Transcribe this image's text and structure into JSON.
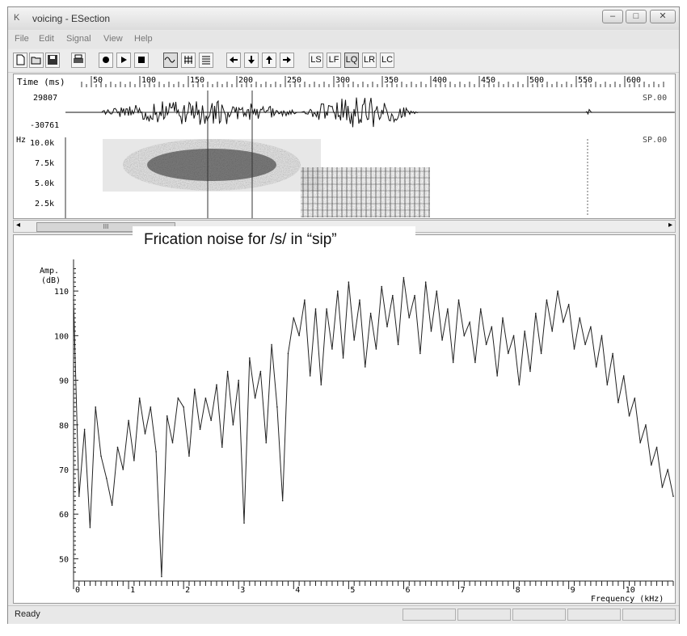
{
  "window": {
    "title": "voicing - ESection",
    "app_icon_label": "K",
    "controls": {
      "minimize": "–",
      "maximize": "□",
      "close": "✕"
    }
  },
  "menu": [
    "File",
    "Edit",
    "Signal",
    "View",
    "Help"
  ],
  "toolbar": {
    "file_buttons": [
      "new-icon",
      "open-icon",
      "save-icon",
      "print-icon"
    ],
    "transport_buttons": [
      "record-icon",
      "play-icon",
      "stop-icon"
    ],
    "view_buttons": [
      "waveform-icon",
      "spectrogram-icon",
      "spectrum-icon"
    ],
    "nav_buttons": [
      "arrow-left-icon",
      "arrow-down-icon",
      "arrow-up-icon",
      "arrow-right-icon"
    ],
    "analysis_buttons": [
      "LS",
      "LF",
      "LQ",
      "LR",
      "LC"
    ],
    "selected_analysis": "LQ"
  },
  "signal_panel": {
    "time_label": "Time (ms)",
    "time_ticks": [
      "50",
      "100",
      "150",
      "200",
      "250",
      "300",
      "350",
      "400",
      "450",
      "500",
      "550",
      "600"
    ],
    "wave_max": "29807",
    "wave_min": "-30761",
    "wave_channel": "SP.00",
    "spectrogram_unit": "Hz",
    "spectrogram_ticks": [
      "10.0k",
      "7.5k",
      "5.0k",
      "2.5k"
    ],
    "spectrogram_channel": "SP.00"
  },
  "scrollbar": {
    "thumb_label": "III",
    "left_arrow": "◂",
    "right_arrow": "▸"
  },
  "caption": "Frication noise for /s/ in “sip”",
  "spectrum": {
    "y_label_line1": "Amp.",
    "y_label_line2": "(dB)",
    "y_ticks": [
      "110",
      "100",
      "90",
      "80",
      "70",
      "60",
      "50"
    ],
    "x_ticks": [
      "0",
      "1",
      "2",
      "3",
      "4",
      "5",
      "6",
      "7",
      "8",
      "9",
      "10"
    ],
    "x_label": "Frequency (kHz)"
  },
  "chart_data": {
    "type": "line",
    "xlabel": "Frequency (kHz)",
    "ylabel": "Amp. (dB)",
    "xlim": [
      0,
      10.9
    ],
    "ylim": [
      45,
      116
    ],
    "x": [
      0.0,
      0.1,
      0.2,
      0.3,
      0.4,
      0.5,
      0.6,
      0.7,
      0.8,
      0.9,
      1.0,
      1.1,
      1.2,
      1.3,
      1.4,
      1.5,
      1.6,
      1.7,
      1.8,
      1.9,
      2.0,
      2.1,
      2.2,
      2.3,
      2.4,
      2.5,
      2.6,
      2.7,
      2.8,
      2.9,
      3.0,
      3.1,
      3.2,
      3.3,
      3.4,
      3.5,
      3.6,
      3.7,
      3.8,
      3.9,
      4.0,
      4.1,
      4.2,
      4.3,
      4.4,
      4.5,
      4.6,
      4.7,
      4.8,
      4.9,
      5.0,
      5.1,
      5.2,
      5.3,
      5.4,
      5.5,
      5.6,
      5.7,
      5.8,
      5.9,
      6.0,
      6.1,
      6.2,
      6.3,
      6.4,
      6.5,
      6.6,
      6.7,
      6.8,
      6.9,
      7.0,
      7.1,
      7.2,
      7.3,
      7.4,
      7.5,
      7.6,
      7.7,
      7.8,
      7.9,
      8.0,
      8.1,
      8.2,
      8.3,
      8.4,
      8.5,
      8.6,
      8.7,
      8.8,
      8.9,
      9.0,
      9.1,
      9.2,
      9.3,
      9.4,
      9.5,
      9.6,
      9.7,
      9.8,
      9.9,
      10.0,
      10.1,
      10.2,
      10.3,
      10.4,
      10.5,
      10.6,
      10.7,
      10.8,
      10.9
    ],
    "y": [
      108,
      64,
      79,
      57,
      84,
      73,
      68,
      62,
      75,
      70,
      81,
      72,
      86,
      78,
      84,
      74,
      46,
      82,
      76,
      86,
      84,
      73,
      88,
      79,
      86,
      81,
      89,
      75,
      92,
      80,
      90,
      58,
      95,
      86,
      92,
      76,
      98,
      84,
      63,
      96,
      104,
      100,
      108,
      91,
      106,
      89,
      106,
      97,
      110,
      95,
      112,
      99,
      108,
      93,
      105,
      97,
      111,
      102,
      109,
      98,
      113,
      104,
      109,
      96,
      112,
      101,
      110,
      99,
      106,
      94,
      108,
      100,
      103,
      94,
      106,
      98,
      102,
      91,
      104,
      96,
      100,
      89,
      101,
      92,
      105,
      96,
      108,
      101,
      110,
      103,
      107,
      97,
      104,
      98,
      102,
      93,
      100,
      89,
      96,
      85,
      91,
      82,
      86,
      76,
      80,
      71,
      75,
      66,
      70,
      64
    ]
  }
}
